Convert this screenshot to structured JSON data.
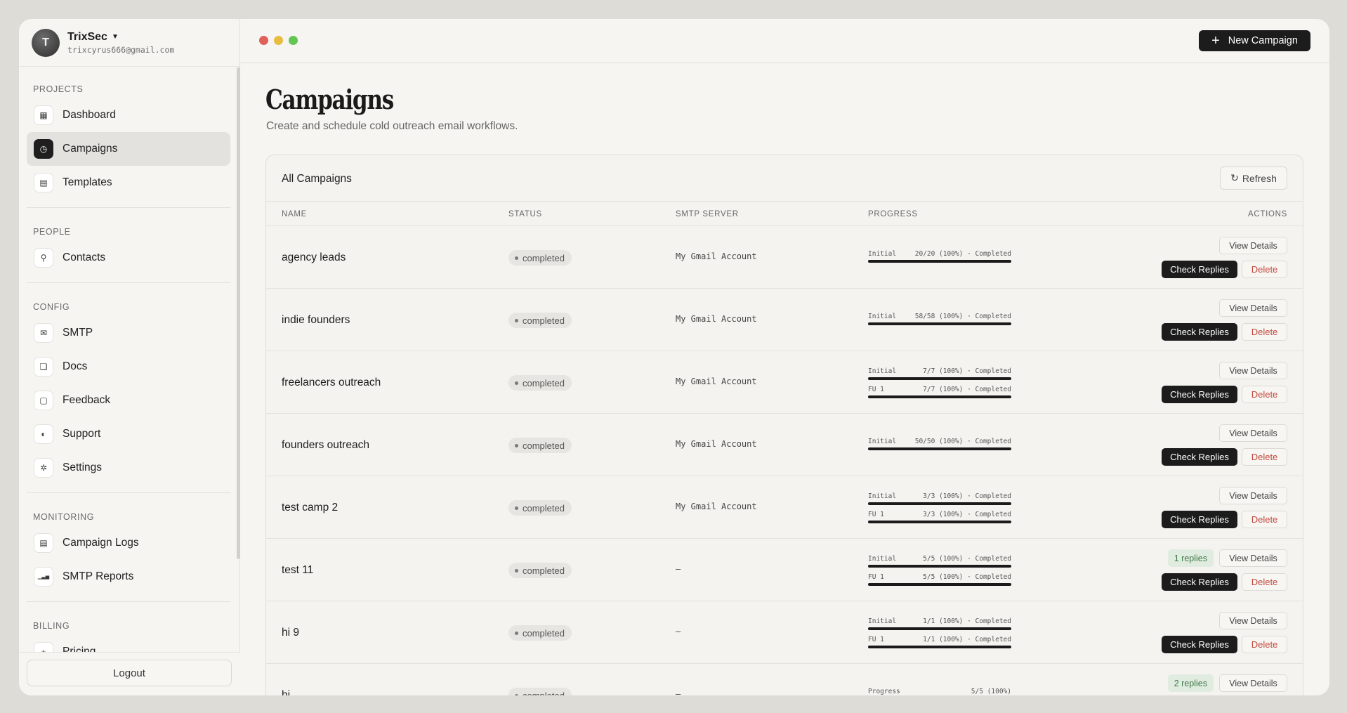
{
  "account": {
    "initial": "T",
    "name": "TrixSec",
    "email": "trixcyrus666@gmail.com"
  },
  "sidebar": {
    "sections": [
      {
        "label": "PROJECTS",
        "items": [
          {
            "label": "Dashboard",
            "icon": "grid-icon",
            "glyph": "▦"
          },
          {
            "label": "Campaigns",
            "icon": "clock-icon",
            "glyph": "◷",
            "active": true
          },
          {
            "label": "Templates",
            "icon": "document-icon",
            "glyph": "▤"
          }
        ]
      },
      {
        "label": "PEOPLE",
        "items": [
          {
            "label": "Contacts",
            "icon": "user-icon",
            "glyph": "⚲"
          }
        ]
      },
      {
        "label": "CONFIG",
        "items": [
          {
            "label": "SMTP",
            "icon": "mail-icon",
            "glyph": "✉"
          },
          {
            "label": "Docs",
            "icon": "file-icon",
            "glyph": "❏"
          },
          {
            "label": "Feedback",
            "icon": "message-icon",
            "glyph": "▢"
          },
          {
            "label": "Support",
            "icon": "support-icon",
            "glyph": "◐"
          },
          {
            "label": "Settings",
            "icon": "gear-icon",
            "glyph": "✲"
          }
        ]
      },
      {
        "label": "MONITORING",
        "items": [
          {
            "label": "Campaign Logs",
            "icon": "log-icon",
            "glyph": "▤"
          },
          {
            "label": "SMTP Reports",
            "icon": "bar-chart-icon",
            "glyph": "▁▃▅"
          }
        ]
      },
      {
        "label": "BILLING",
        "items": [
          {
            "label": "Pricing",
            "icon": "plus-icon",
            "glyph": "+"
          }
        ]
      }
    ],
    "logout_label": "Logout"
  },
  "window_dots": [
    "#e0605a",
    "#e8bd3f",
    "#63c553"
  ],
  "header": {
    "new_campaign_label": "New Campaign"
  },
  "page": {
    "title": "Campaigns",
    "subtitle": "Create and schedule cold outreach email workflows."
  },
  "card": {
    "title": "All Campaigns",
    "refresh_label": "Refresh"
  },
  "table": {
    "columns": [
      "NAME",
      "STATUS",
      "SMTP SERVER",
      "PROGRESS",
      "ACTIONS"
    ],
    "rows": [
      {
        "name": "agency leads",
        "status": "completed",
        "smtp": "My Gmail Account",
        "progress": [
          {
            "label": "Initial",
            "detail": "20/20 (100%) · Completed",
            "fraction": 1.0
          }
        ],
        "replies": null
      },
      {
        "name": "indie founders",
        "status": "completed",
        "smtp": "My Gmail Account",
        "progress": [
          {
            "label": "Initial",
            "detail": "58/58 (100%) · Completed",
            "fraction": 1.0
          }
        ],
        "replies": null
      },
      {
        "name": "freelancers outreach",
        "status": "completed",
        "smtp": "My Gmail Account",
        "progress": [
          {
            "label": "Initial",
            "detail": "7/7 (100%) · Completed",
            "fraction": 1.0
          },
          {
            "label": "FU 1",
            "detail": "7/7 (100%) · Completed",
            "fraction": 1.0
          }
        ],
        "replies": null
      },
      {
        "name": "founders outreach",
        "status": "completed",
        "smtp": "My Gmail Account",
        "progress": [
          {
            "label": "Initial",
            "detail": "50/50 (100%) · Completed",
            "fraction": 1.0
          }
        ],
        "replies": null
      },
      {
        "name": "test camp 2",
        "status": "completed",
        "smtp": "My Gmail Account",
        "progress": [
          {
            "label": "Initial",
            "detail": "3/3 (100%) · Completed",
            "fraction": 1.0
          },
          {
            "label": "FU 1",
            "detail": "3/3 (100%) · Completed",
            "fraction": 1.0
          }
        ],
        "replies": null
      },
      {
        "name": "test 11",
        "status": "completed",
        "smtp": "–",
        "progress": [
          {
            "label": "Initial",
            "detail": "5/5 (100%) · Completed",
            "fraction": 1.0
          },
          {
            "label": "FU 1",
            "detail": "5/5 (100%) · Completed",
            "fraction": 1.0
          }
        ],
        "replies": "1 replies"
      },
      {
        "name": "hi 9",
        "status": "completed",
        "smtp": "–",
        "progress": [
          {
            "label": "Initial",
            "detail": "1/1 (100%) · Completed",
            "fraction": 1.0
          },
          {
            "label": "FU 1",
            "detail": "1/1 (100%) · Completed",
            "fraction": 1.0
          }
        ],
        "replies": null
      },
      {
        "name": "hi",
        "status": "completed",
        "smtp": "–",
        "progress": [
          {
            "label": "Progress",
            "detail": "5/5 (100%)",
            "fraction": 1.0
          }
        ],
        "replies": "2 replies"
      }
    ],
    "actions": {
      "view": "View Details",
      "check": "Check Replies",
      "delete": "Delete"
    }
  }
}
